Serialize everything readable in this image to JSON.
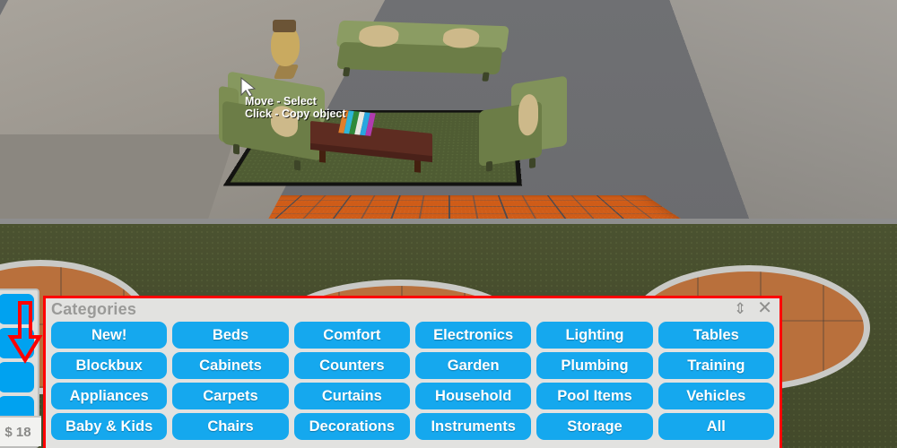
{
  "scene": {
    "tooltip": {
      "line1": "Move - Select",
      "line2": "Click - Copy object"
    },
    "colors": {
      "floor_orange": "#cf5c18",
      "lawn_green": "#464d2d",
      "wall_gray": "#9c978f",
      "furniture_green": "#7d8f55",
      "rug_green": "#4f5c33",
      "table_brown": "#5e2c21"
    },
    "book_colors": [
      "#e07f2a",
      "#2fb6d8",
      "#2f8a3a",
      "#e8e8e0",
      "#29a7e0",
      "#b03bb0"
    ]
  },
  "sidebar": {
    "buttons": [
      {
        "label": "",
        "name": "sidebar-button-1"
      },
      {
        "label": "",
        "name": "sidebar-button-2"
      },
      {
        "label": "",
        "name": "sidebar-button-3"
      },
      {
        "label": "",
        "name": "sidebar-button-4"
      }
    ],
    "money": "$ 18"
  },
  "annotation": {
    "arrow_color": "#ff0000",
    "highlight_color": "#ff0000"
  },
  "categories_panel": {
    "title": "Categories",
    "resize_icon": "⇕",
    "close_icon": "✕",
    "accent_color": "#15a8ee",
    "buttons": [
      {
        "label": "New!",
        "name": "category-new"
      },
      {
        "label": "Beds",
        "name": "category-beds"
      },
      {
        "label": "Comfort",
        "name": "category-comfort"
      },
      {
        "label": "Electronics",
        "name": "category-electronics"
      },
      {
        "label": "Lighting",
        "name": "category-lighting"
      },
      {
        "label": "Tables",
        "name": "category-tables"
      },
      {
        "label": "Blockbux",
        "name": "category-blockbux"
      },
      {
        "label": "Cabinets",
        "name": "category-cabinets"
      },
      {
        "label": "Counters",
        "name": "category-counters"
      },
      {
        "label": "Garden",
        "name": "category-garden"
      },
      {
        "label": "Plumbing",
        "name": "category-plumbing"
      },
      {
        "label": "Training",
        "name": "category-training"
      },
      {
        "label": "Appliances",
        "name": "category-appliances"
      },
      {
        "label": "Carpets",
        "name": "category-carpets"
      },
      {
        "label": "Curtains",
        "name": "category-curtains"
      },
      {
        "label": "Household",
        "name": "category-household"
      },
      {
        "label": "Pool Items",
        "name": "category-pool-items"
      },
      {
        "label": "Vehicles",
        "name": "category-vehicles"
      },
      {
        "label": "Baby & Kids",
        "name": "category-baby-kids"
      },
      {
        "label": "Chairs",
        "name": "category-chairs"
      },
      {
        "label": "Decorations",
        "name": "category-decorations"
      },
      {
        "label": "Instruments",
        "name": "category-instruments"
      },
      {
        "label": "Storage",
        "name": "category-storage"
      },
      {
        "label": "All",
        "name": "category-all"
      }
    ]
  }
}
